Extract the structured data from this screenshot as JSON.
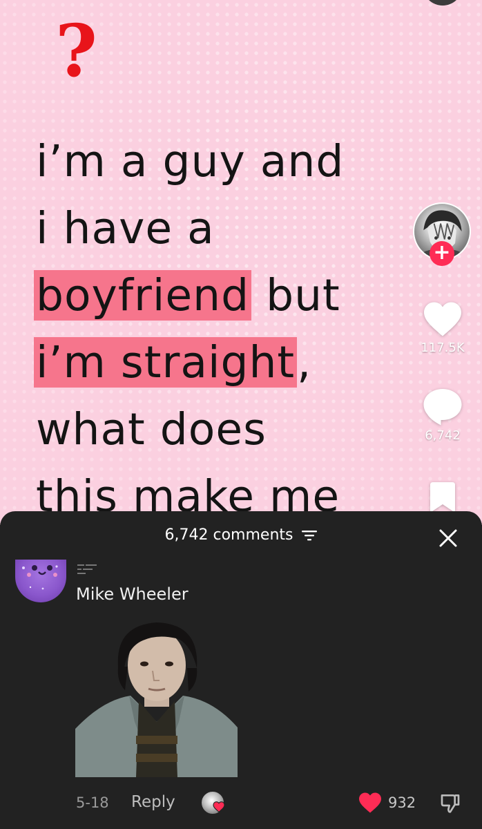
{
  "video": {
    "question_mark": "?",
    "caption_lines": [
      {
        "text": "i’m a guy and",
        "highlight": false
      },
      {
        "text": "i have a",
        "highlight": false
      },
      {
        "text": "boyfriend",
        "after": " but",
        "highlight": true
      },
      {
        "text": "i’m straight",
        "after": ",",
        "highlight": true
      },
      {
        "text": "what does",
        "highlight": false
      },
      {
        "text": "this make me",
        "highlight": false
      }
    ],
    "colors": {
      "background": "#fbd0e0",
      "highlight": "#f6758c",
      "question": "#e8141a",
      "text": "#141414"
    }
  },
  "right_rail": {
    "creator_avatar": "manga-character-avatar",
    "follow_icon": "+",
    "like_count": "117.5K",
    "comment_count": "6,742",
    "bookmark_icon": "bookmark-icon"
  },
  "comments_sheet": {
    "header": "6,742 comments",
    "close_icon": "close-icon",
    "filter_icon": "filter-icon",
    "comment": {
      "avatar": "purple-cat-avatar",
      "author": "Mike Wheeler",
      "image": "photo-of-young-man-in-jacket",
      "date": "5-18",
      "reply_label": "Reply",
      "like_count": "932",
      "liked": true,
      "colors": {
        "like": "#fe2c55"
      }
    }
  }
}
